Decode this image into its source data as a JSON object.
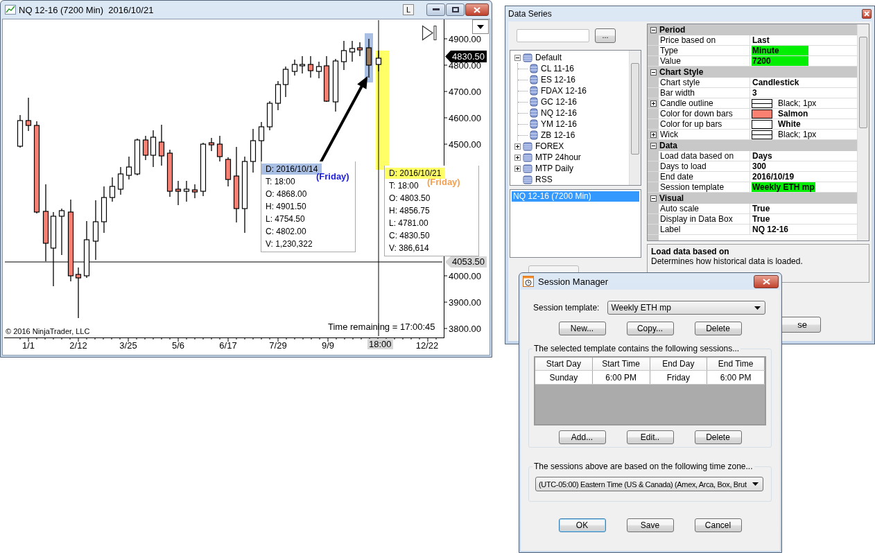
{
  "chart_window": {
    "title": "NQ 12-16 (7200 Min)  2016/10/21",
    "lock_button": "L",
    "price_axis": [
      "4900.00",
      "4800.00",
      "4700.00",
      "4600.00",
      "4500.00",
      "4000.00",
      "3900.00",
      "3800.00"
    ],
    "last_price": "4830.50",
    "crosshair_price": "4053.50",
    "date_axis": [
      "1/1",
      "2/12",
      "3/25",
      "5/6",
      "6/17",
      "7/29",
      "9/9",
      "12/22"
    ],
    "crosshair_time": "18:00",
    "copyright": "© 2016 NinjaTrader, LLC",
    "time_remaining": "Time remaining = 17:00:45",
    "tooltips": [
      {
        "lines": [
          "D: 2016/10/14",
          "T: 18:00",
          "O: 4868.00",
          "H: 4901.50",
          "L: 4754.50",
          "C: 4802.00",
          "V: 1,230,322"
        ],
        "day": "(Friday)",
        "color": "#2020e0",
        "highlight": {
          "color": "#a9bfe3"
        }
      },
      {
        "lines": [
          "D: 2016/10/21",
          "T: 18:00",
          "O: 4803.50",
          "H: 4856.75",
          "L: 4781.00",
          "C: 4830.50",
          "V: 386,614"
        ],
        "day": "(Friday)",
        "color": "#f5a050",
        "highlight": {
          "color": "#ffff66"
        }
      }
    ]
  },
  "data_series": {
    "title": "Data Series",
    "browse_button": "...",
    "tree": [
      {
        "label": "Default",
        "expanded": true,
        "children": [
          {
            "label": "CL 11-16"
          },
          {
            "label": "ES 12-16"
          },
          {
            "label": "FDAX 12-16"
          },
          {
            "label": "GC 12-16"
          },
          {
            "label": "NQ 12-16"
          },
          {
            "label": "YM 12-16"
          },
          {
            "label": "ZB 12-16"
          }
        ]
      },
      {
        "label": "FOREX",
        "expanded": false
      },
      {
        "label": "MTP 24hour",
        "expanded": false
      },
      {
        "label": "MTP Daily",
        "expanded": false
      },
      {
        "label": "RSS"
      }
    ],
    "series_list": [
      {
        "label": "NQ 12-16 (7200 Min)",
        "selected": true
      }
    ],
    "properties": [
      {
        "category": "Period",
        "expanded": true,
        "rows": [
          {
            "label": "Price based on",
            "value": "Last",
            "kind": "text",
            "highlighted": false
          },
          {
            "label": "Type",
            "value": "Minute",
            "kind": "text",
            "highlighted": true
          },
          {
            "label": "Value",
            "value": "7200",
            "kind": "text",
            "highlighted": true
          }
        ]
      },
      {
        "category": "Chart Style",
        "expanded": true,
        "rows": [
          {
            "label": "Chart style",
            "value": "Candlestick",
            "kind": "text",
            "highlighted": false
          },
          {
            "label": "Bar width",
            "value": "3",
            "kind": "text",
            "highlighted": false
          },
          {
            "label": "Candle outline",
            "value": "Black; 1px",
            "kind": "line",
            "expanded": false
          },
          {
            "label": "Color for down bars",
            "value": "Salmon",
            "kind": "swatch",
            "color": "#fa8072"
          },
          {
            "label": "Color for up bars",
            "value": "White",
            "kind": "swatch",
            "color": "#ffffff"
          },
          {
            "label": "Wick",
            "value": "Black; 1px",
            "kind": "line",
            "expanded": false
          }
        ]
      },
      {
        "category": "Data",
        "expanded": true,
        "rows": [
          {
            "label": "Load data based on",
            "value": "Days",
            "kind": "text",
            "highlighted": false
          },
          {
            "label": "Days to load",
            "value": "300",
            "kind": "text",
            "highlighted": false
          },
          {
            "label": "End date",
            "value": "2016/10/19",
            "kind": "text",
            "highlighted": false
          },
          {
            "label": "Session template",
            "value": "Weekly ETH mp",
            "kind": "text",
            "highlighted": true
          }
        ]
      },
      {
        "category": "Visual",
        "expanded": true,
        "rows": [
          {
            "label": "Auto scale",
            "value": "True",
            "kind": "text",
            "highlighted": false
          },
          {
            "label": "Display in Data Box",
            "value": "True",
            "kind": "text",
            "highlighted": false
          },
          {
            "label": "Label",
            "value": "NQ 12-16",
            "kind": "text",
            "highlighted": false
          }
        ]
      }
    ],
    "description": {
      "title": "Load data based on",
      "text": "Determines how historical data is loaded."
    },
    "close_button": "se"
  },
  "session_manager": {
    "title": "Session Manager",
    "template_label": "Session template:",
    "template": "Weekly ETH mp",
    "template_buttons": [
      "New...",
      "Copy...",
      "Delete"
    ],
    "sessions_group": "The selected template contains the following sessions...",
    "columns": [
      "Start Day",
      "Start Time",
      "End Day",
      "End Time"
    ],
    "rows": [
      [
        "Sunday",
        "6:00 PM",
        "Friday",
        "6:00 PM"
      ]
    ],
    "session_buttons": [
      "Add...",
      "Edit..",
      "Delete"
    ],
    "timezone_group": "The sessions above are based on the following time zone...",
    "timezone": "(UTC-05:00) Eastern Time (US & Canada) (Amex, Arca, Box, Brut",
    "buttons": [
      {
        "label": "OK",
        "focused": true
      },
      {
        "label": "Save",
        "focused": false
      },
      {
        "label": "Cancel",
        "focused": false
      }
    ]
  }
}
